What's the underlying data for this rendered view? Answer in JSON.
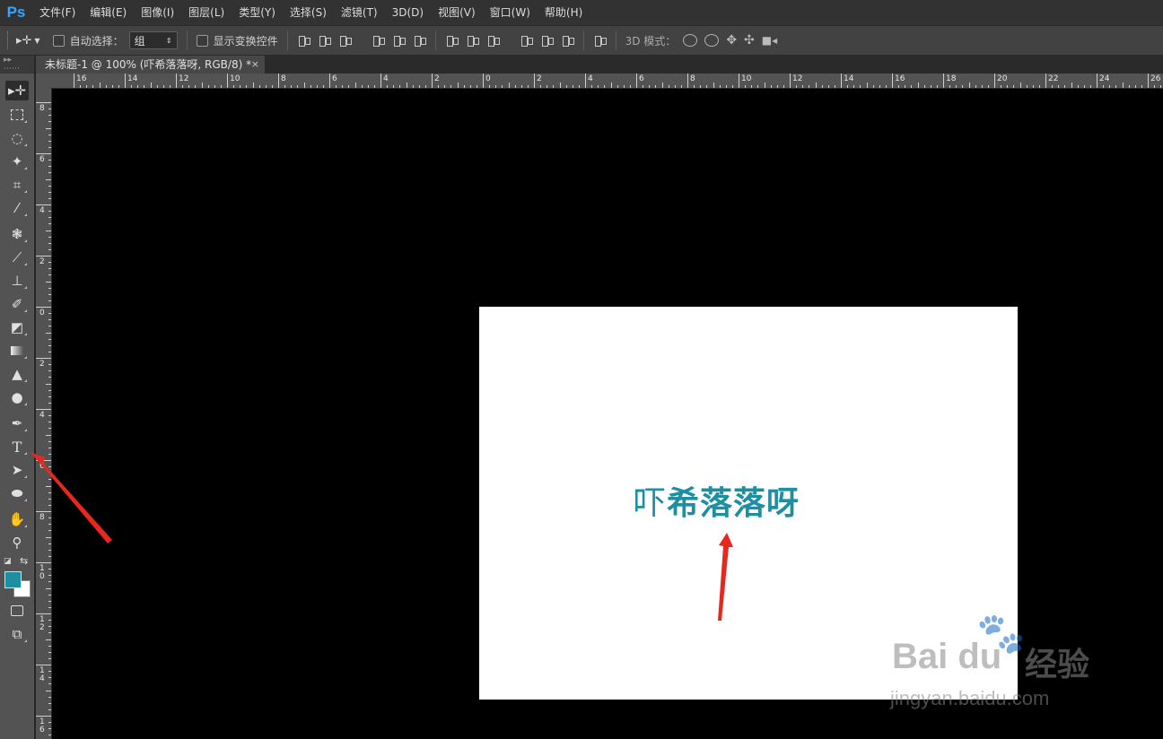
{
  "app": {
    "logo": "Ps"
  },
  "menu": [
    "文件(F)",
    "编辑(E)",
    "图像(I)",
    "图层(L)",
    "类型(Y)",
    "选择(S)",
    "滤镜(T)",
    "3D(D)",
    "视图(V)",
    "窗口(W)",
    "帮助(H)"
  ],
  "options": {
    "tool_icon": "move-tool-icon",
    "auto_select_label": "自动选择：",
    "auto_select_value": "组",
    "show_transform_label": "显示变换控件",
    "mode3d_label": "3D 模式："
  },
  "document": {
    "tab_title": "未标题-1 @ 100% (吓希落落呀, RGB/8) *",
    "close_glyph": "×",
    "canvas_text_first": "吓",
    "canvas_text_rest": "希落落呀"
  },
  "ruler_top_labels": [
    "16",
    "14",
    "12",
    "10",
    "8",
    "6",
    "4",
    "2",
    "0",
    "2",
    "4",
    "6",
    "8",
    "10",
    "12",
    "14",
    "16",
    "18",
    "20",
    "22",
    "24",
    "26"
  ],
  "ruler_left_labels": [
    "8",
    "6",
    "4",
    "2",
    "0",
    "2",
    "4",
    "6",
    "8",
    "1\n0",
    "1\n2",
    "1\n4",
    "1\n6"
  ],
  "colors": {
    "foreground": "#1d8fa0",
    "background": "#ffffff",
    "arrow": "#e8281e"
  },
  "tools": [
    "move-tool-icon",
    "marquee-icon",
    "lasso-icon",
    "magic-wand-icon",
    "crop-icon",
    "eyedropper-icon",
    "healing-brush-icon",
    "brush-icon",
    "stamp-icon",
    "history-brush-icon",
    "eraser-icon",
    "gradient-icon",
    "blur-icon",
    "dodge-icon",
    "pen-icon",
    "type-icon",
    "path-select-icon",
    "ellipse-icon",
    "hand-icon",
    "zoom-icon"
  ],
  "watermark": {
    "logo": "Bai du",
    "cn": "经验",
    "url": "jingyan.baidu.com"
  }
}
